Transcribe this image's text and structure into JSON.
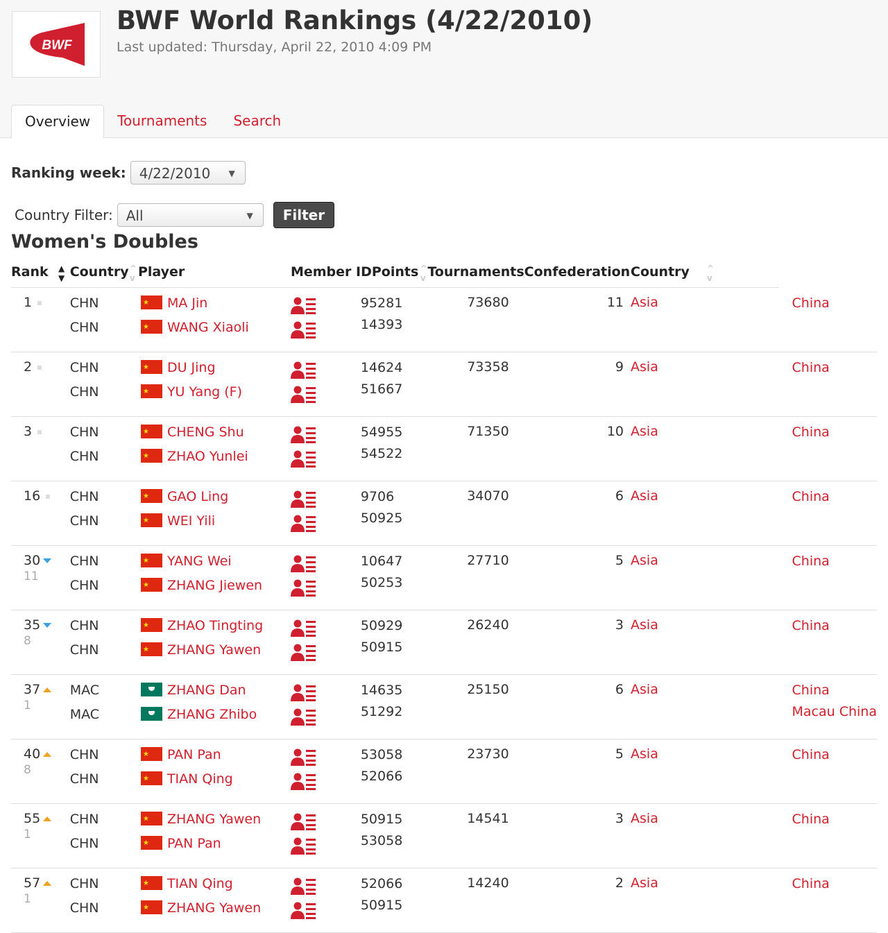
{
  "header": {
    "logo_text": "BWF",
    "title": "BWF World Rankings (4/22/2010)",
    "subtitle": "Last updated: Thursday, April 22, 2010 4:09 PM"
  },
  "tabs": [
    {
      "label": "Overview",
      "active": true
    },
    {
      "label": "Tournaments",
      "active": false
    },
    {
      "label": "Search",
      "active": false
    }
  ],
  "filters": {
    "ranking_week_label": "Ranking week:",
    "ranking_week_value": "4/22/2010",
    "country_filter_label": "Country Filter:",
    "country_filter_value": "All",
    "filter_button": "Filter"
  },
  "section_title": "Women's Doubles",
  "columns": {
    "rank": "Rank",
    "country": "Country",
    "player": "Player",
    "member_id": "Member ID",
    "points": "Points",
    "tournaments": "Tournaments",
    "confederation": "Confederation",
    "country2": "Country"
  },
  "rows": [
    {
      "rank": "1",
      "change_dir": "none",
      "change": "",
      "countries": [
        "CHN",
        "CHN"
      ],
      "flags": [
        "chn",
        "chn"
      ],
      "players": [
        "MA Jin",
        "WANG Xiaoli"
      ],
      "ids": [
        "95281",
        "14393"
      ],
      "points": "73680",
      "tournaments": "11",
      "confederation": "Asia",
      "country_names": [
        "China"
      ]
    },
    {
      "rank": "2",
      "change_dir": "none",
      "change": "",
      "countries": [
        "CHN",
        "CHN"
      ],
      "flags": [
        "chn",
        "chn"
      ],
      "players": [
        "DU Jing",
        "YU Yang (F)"
      ],
      "ids": [
        "14624",
        "51667"
      ],
      "points": "73358",
      "tournaments": "9",
      "confederation": "Asia",
      "country_names": [
        "China"
      ]
    },
    {
      "rank": "3",
      "change_dir": "none",
      "change": "",
      "countries": [
        "CHN",
        "CHN"
      ],
      "flags": [
        "chn",
        "chn"
      ],
      "players": [
        "CHENG Shu",
        "ZHAO Yunlei"
      ],
      "ids": [
        "54955",
        "54522"
      ],
      "points": "71350",
      "tournaments": "10",
      "confederation": "Asia",
      "country_names": [
        "China"
      ]
    },
    {
      "rank": "16",
      "change_dir": "none",
      "change": "",
      "countries": [
        "CHN",
        "CHN"
      ],
      "flags": [
        "chn",
        "chn"
      ],
      "players": [
        "GAO Ling",
        "WEI Yili"
      ],
      "ids": [
        "9706",
        "50925"
      ],
      "points": "34070",
      "tournaments": "6",
      "confederation": "Asia",
      "country_names": [
        "China"
      ]
    },
    {
      "rank": "30",
      "change_dir": "down",
      "change": "11",
      "countries": [
        "CHN",
        "CHN"
      ],
      "flags": [
        "chn",
        "chn"
      ],
      "players": [
        "YANG Wei",
        "ZHANG Jiewen"
      ],
      "ids": [
        "10647",
        "50253"
      ],
      "points": "27710",
      "tournaments": "5",
      "confederation": "Asia",
      "country_names": [
        "China"
      ]
    },
    {
      "rank": "35",
      "change_dir": "down",
      "change": "8",
      "countries": [
        "CHN",
        "CHN"
      ],
      "flags": [
        "chn",
        "chn"
      ],
      "players": [
        "ZHAO Tingting",
        "ZHANG Yawen"
      ],
      "ids": [
        "50929",
        "50915"
      ],
      "points": "26240",
      "tournaments": "3",
      "confederation": "Asia",
      "country_names": [
        "China"
      ]
    },
    {
      "rank": "37",
      "change_dir": "up",
      "change": "1",
      "countries": [
        "MAC",
        "MAC"
      ],
      "flags": [
        "mac",
        "mac"
      ],
      "players": [
        "ZHANG Dan",
        "ZHANG Zhibo"
      ],
      "ids": [
        "14635",
        "51292"
      ],
      "points": "25150",
      "tournaments": "6",
      "confederation": "Asia",
      "country_names": [
        "China",
        "Macau China"
      ]
    },
    {
      "rank": "40",
      "change_dir": "up",
      "change": "8",
      "countries": [
        "CHN",
        "CHN"
      ],
      "flags": [
        "chn",
        "chn"
      ],
      "players": [
        "PAN Pan",
        "TIAN Qing"
      ],
      "ids": [
        "53058",
        "52066"
      ],
      "points": "23730",
      "tournaments": "5",
      "confederation": "Asia",
      "country_names": [
        "China"
      ]
    },
    {
      "rank": "55",
      "change_dir": "up",
      "change": "1",
      "countries": [
        "CHN",
        "CHN"
      ],
      "flags": [
        "chn",
        "chn"
      ],
      "players": [
        "ZHANG Yawen",
        "PAN Pan"
      ],
      "ids": [
        "50915",
        "53058"
      ],
      "points": "14541",
      "tournaments": "3",
      "confederation": "Asia",
      "country_names": [
        "China"
      ]
    },
    {
      "rank": "57",
      "change_dir": "up",
      "change": "1",
      "countries": [
        "CHN",
        "CHN"
      ],
      "flags": [
        "chn",
        "chn"
      ],
      "players": [
        "TIAN Qing",
        "ZHANG Yawen"
      ],
      "ids": [
        "52066",
        "50915"
      ],
      "points": "14240",
      "tournaments": "2",
      "confederation": "Asia",
      "country_names": [
        "China"
      ]
    }
  ],
  "colors": {
    "accent_red": "#d0202f",
    "rank_down": "#3aa0e0",
    "rank_up": "#f0a020"
  },
  "icons": {
    "player_profile": "player-profile-icon",
    "sort": "sort-icon"
  }
}
